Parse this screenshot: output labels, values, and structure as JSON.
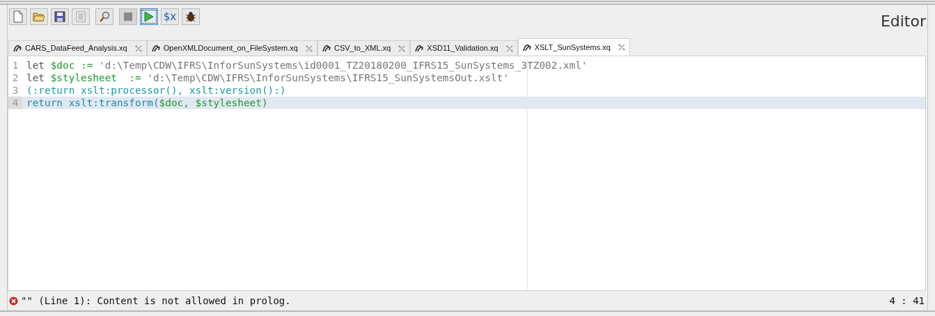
{
  "toolbar": [
    {
      "kind": "new",
      "disabled": false,
      "focused": false
    },
    {
      "kind": "open",
      "disabled": false,
      "focused": false
    },
    {
      "kind": "save",
      "disabled": false,
      "focused": false
    },
    {
      "kind": "list",
      "disabled": false,
      "focused": false
    },
    {
      "kind": "find",
      "disabled": false,
      "focused": false
    },
    {
      "kind": "stop",
      "disabled": true,
      "focused": false
    },
    {
      "kind": "run",
      "disabled": false,
      "focused": true
    },
    {
      "kind": "text",
      "label": "$x",
      "disabled": false,
      "focused": false
    },
    {
      "kind": "bug",
      "disabled": false,
      "focused": false
    }
  ],
  "panel_title": "Editor",
  "tabs": [
    {
      "label": "CARS_DataFeed_Analysis.xq",
      "selected": false
    },
    {
      "label": "OpenXMLDocument_on_FileSystem.xq",
      "selected": false
    },
    {
      "label": "CSV_to_XML.xq",
      "selected": false
    },
    {
      "label": "XSD11_Validation.xq",
      "selected": false
    },
    {
      "label": "XSLT_SunSystems.xq",
      "selected": true
    }
  ],
  "lines": [
    {
      "number": "1",
      "current": false,
      "tokens": [
        {
          "kind": "keyword",
          "text": "let "
        },
        {
          "kind": "variable",
          "text": "$doc := "
        },
        {
          "kind": "string",
          "text": "'d:\\Temp\\CDW\\IFRS\\InforSunSystems\\id0001_TZ20180200_IFRS15_SunSystems_3TZ002.xml'"
        }
      ]
    },
    {
      "number": "2",
      "current": false,
      "tokens": [
        {
          "kind": "keyword",
          "text": "let "
        },
        {
          "kind": "variable",
          "text": "$stylesheet  := "
        },
        {
          "kind": "string",
          "text": "'d:\\Temp\\CDW\\IFRS\\InforSunSystems\\IFRS15_SunSystemsOut.xslt'"
        }
      ]
    },
    {
      "number": "3",
      "current": false,
      "tokens": [
        {
          "kind": "comment",
          "text": "(:return xslt:processor(), xslt:version():)"
        }
      ]
    },
    {
      "number": "4",
      "current": true,
      "tokens": [
        {
          "kind": "function",
          "text": "return xslt:transform("
        },
        {
          "kind": "variable",
          "text": "$doc, $stylesheet)"
        }
      ]
    }
  ],
  "status": {
    "message": "\"\" (Line 1): Content is not allowed in prolog.",
    "position": "4 : 41"
  }
}
